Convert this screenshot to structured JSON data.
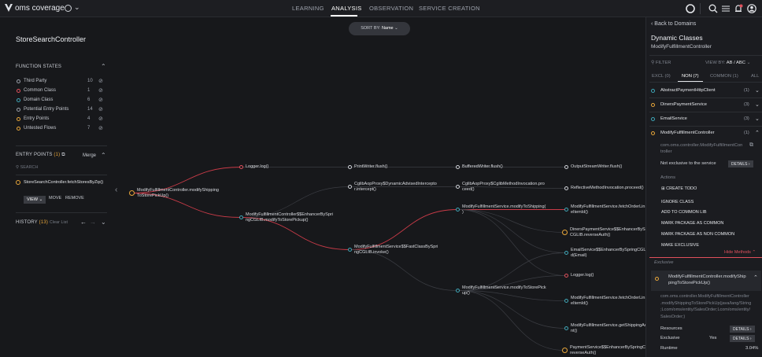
{
  "app": {
    "title": "oms coverage"
  },
  "nav": {
    "tabs": [
      "LEARNING",
      "ANALYSIS",
      "OBSERVATION",
      "SERVICE CREATION"
    ],
    "active": "ANALYSIS"
  },
  "left": {
    "controller": "StoreSearchController",
    "function_states_title": "FUNCTION STATES",
    "states": [
      {
        "label": "Third Party",
        "count": "10",
        "color": "#9aa0aa"
      },
      {
        "label": "Common Class",
        "count": "1",
        "color": "#e0505c"
      },
      {
        "label": "Domain Class",
        "count": "6",
        "color": "#3fa7b8"
      },
      {
        "label": "Potential Entry Points",
        "count": "14",
        "color": "#9aa0aa"
      },
      {
        "label": "Entry Points",
        "count": "4",
        "color": "#e8a63a"
      },
      {
        "label": "Untested Flows",
        "count": "7",
        "color": "#e8a63a"
      }
    ],
    "entry_points_title": "ENTRY POINTS",
    "entry_points_count": "(1)",
    "merge_label": "Merge",
    "search_placeholder": "SEARCH",
    "entry_item": "StoreSearchController.fetchStoresByZip()",
    "view_label": "VIEW",
    "move_label": "MOVE",
    "remove_label": "REMOVE",
    "history_title": "HISTORY",
    "history_count": "(13)",
    "clear_list": "Clear List"
  },
  "graph": {
    "sort_label": "SORT BY:",
    "sort_value": "Name",
    "nodes": [
      {
        "id": "root",
        "label": "ModifyFulfillmentController.modifyShipping\nToStorePickUp()",
        "color": "#e8a63a"
      },
      {
        "id": "logger1",
        "label": "Logger.log()",
        "color": "#e0505c"
      },
      {
        "id": "print",
        "label": "PrintWriter.flush()",
        "color": "#cfd2d8"
      },
      {
        "id": "buffered",
        "label": "BufferedWriter.flush()",
        "color": "#cfd2d8"
      },
      {
        "id": "output",
        "label": "OutputStreamWriter.flush()",
        "color": "#cfd2d8"
      },
      {
        "id": "cglib",
        "label": "CglibAopProxy$DynamicAdvisedIntercepto\nr.intercept()",
        "color": "#cfd2d8"
      },
      {
        "id": "cglibmi",
        "label": "CglibAopProxy$CglibMethodInvocation.pro\nceed()",
        "color": "#cfd2d8"
      },
      {
        "id": "reflective",
        "label": "ReflectiveMethodInvocation.proceed()",
        "color": "#cfd2d8"
      },
      {
        "id": "enhancer",
        "label": "ModifyFulfillmentController$$EnhancerBySpri\nngCGLIB.modifyToStorePickup()",
        "color": "#3fa7b8"
      },
      {
        "id": "fastclass",
        "label": "ModifyFulfillmentService$$FastClassBySpri\nngCGLIB.invoke()",
        "color": "#3fa7b8"
      },
      {
        "id": "svcShipping",
        "label": "ModifyFulfillmentService.modifyToShipping(\n)",
        "color": "#3fa7b8"
      },
      {
        "id": "fetchOrder1",
        "label": "ModifyFulfillmentService.fetchOrderLin\neItemId()",
        "color": "#3fa7b8"
      },
      {
        "id": "diners",
        "label": "DinersPaymentService$$EnhancerBySp\nCGLIB.reverseAuth()",
        "color": "#e8a63a"
      },
      {
        "id": "email",
        "label": "EmailService$$EnhancerBySpringCGLI\nd(Email)",
        "color": "#3fa7b8"
      },
      {
        "id": "logger2",
        "label": "Logger.log()",
        "color": "#e0505c"
      },
      {
        "id": "svcPick",
        "label": "ModifyFulfillmentService.modifyToStorePick\nup()",
        "color": "#3fa7b8"
      },
      {
        "id": "fetchOrder2",
        "label": "ModifyFulfillmentService.fetchOrderLin\neItemId()",
        "color": "#3fa7b8"
      },
      {
        "id": "getShipping",
        "label": "ModifyFulfillmentService.getShippingAd\nnt()",
        "color": "#3fa7b8"
      },
      {
        "id": "payment",
        "label": "PaymentService$$EnhancerBySpringCGL\nreverseAuth()",
        "color": "#e8a63a"
      }
    ]
  },
  "right": {
    "back": "Back to Domains",
    "title": "Dynamic Classes",
    "subtitle": "ModifyFulfillmentController",
    "filter_placeholder": "FILTER",
    "view_by": "VIEW BY:",
    "view_by_value": "AB / ABC",
    "tabs": [
      "EXCL (0)",
      "NON (7)",
      "COMMON (1)",
      "ALL"
    ],
    "active_tab": "NON (7)",
    "classes": [
      {
        "name": "AbstractPaymentHttpClient",
        "count": "(1)",
        "color": "#3fa7b8"
      },
      {
        "name": "DinersPaymentService",
        "count": "(3)",
        "color": "#e8a63a"
      },
      {
        "name": "EmailService",
        "count": "(3)",
        "color": "#3fa7b8"
      },
      {
        "name": "ModifyFulfillmentController",
        "count": "(1)",
        "color": "#e8a63a"
      }
    ],
    "package_path": "com.oms.controller.ModifyFulfillmentCon\ntroller",
    "not_exclusive": "Not exclusive to the service",
    "details_label": "DETAILS",
    "actions_title": "Actions",
    "actions": [
      "CREATE TODO",
      "IGNORE CLASS",
      "ADD TO COMMON LIB",
      "MARK PACKAGE AS COMMON",
      "MARK PACKAGE AS NON COMMON",
      "MAKE EXCLUSIVE"
    ],
    "hide_methods": "Hide Methods",
    "exclusive_title": "Exclusive",
    "method_name": "ModifyFulfillmentController.modifyShip\npingToStorePickUp()",
    "method_sig": "com.oms.controller.ModifyFulfillmentController\n.modifyShippingToStorePickUp(java/lang/String\n;Lcom/oms/entity/SalesOrder;Lcom/oms/entity/\nSalesOrder;)",
    "resources_label": "Resources",
    "exclusive_label": "Exclusive",
    "exclusive_value": "Yes",
    "runtime_label": "Runtime",
    "runtime_value": "3.04%"
  }
}
